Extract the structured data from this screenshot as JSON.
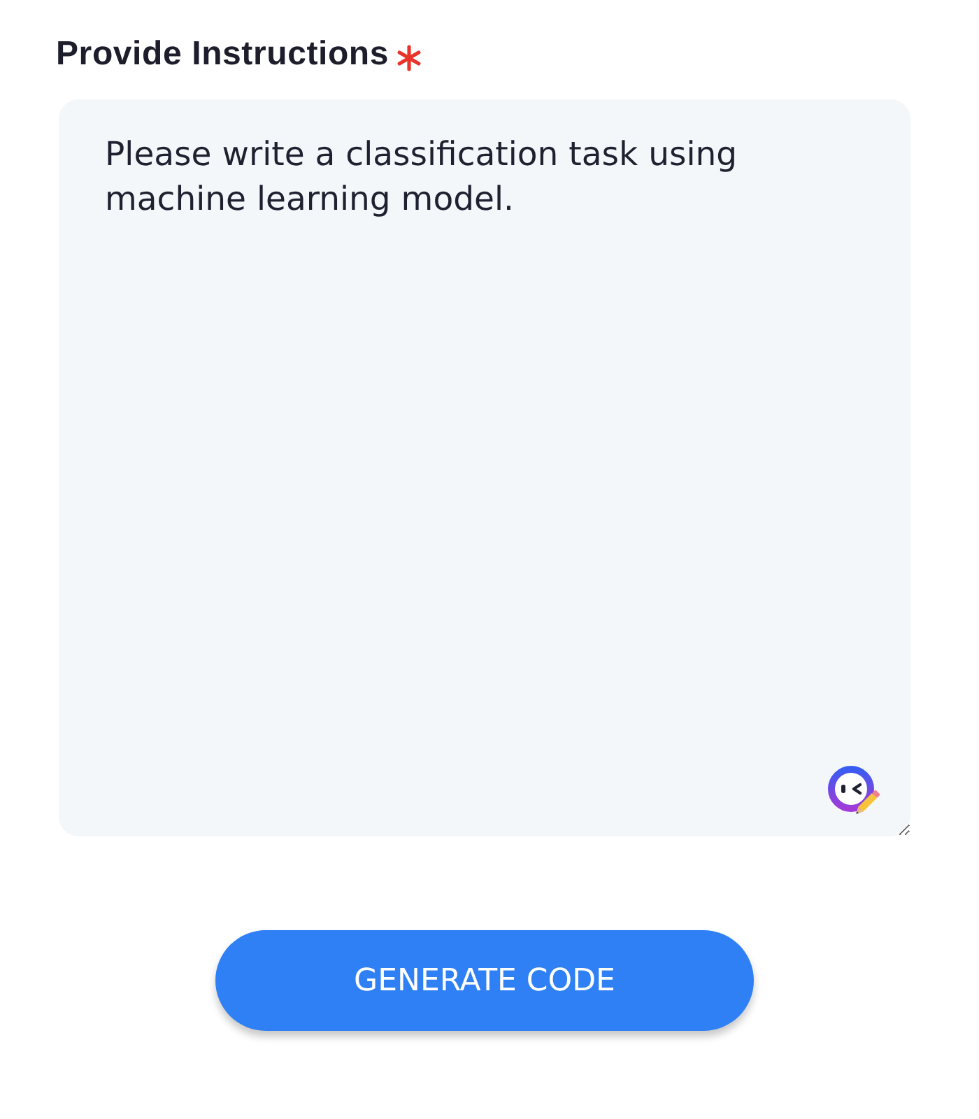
{
  "field": {
    "label": "Provide Instructions",
    "required": true,
    "value": "Please write a classification task using machine learning model."
  },
  "button": {
    "label": "GENERATE CODE"
  }
}
